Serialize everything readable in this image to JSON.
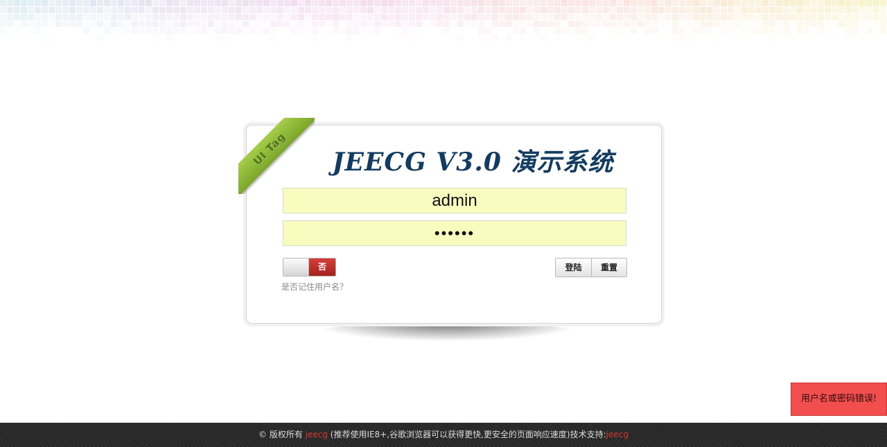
{
  "colors": {
    "title": "#133c63",
    "field_background": "#f8fcbf",
    "ribbon": "#8cb73a",
    "toggle_on": "#c1302b",
    "toast_background": "#f24e4e",
    "footer_background": "#262626",
    "footer_link": "#d8392f"
  },
  "ribbon": {
    "label": "UI Tag"
  },
  "login": {
    "title": "JEECG  V3.0 演示系统",
    "username_value": "admin",
    "password_value": "••••••",
    "remember_toggle_text": "否",
    "remember_label": "是否记住用户名？",
    "login_button": "登陆",
    "reset_button": "重置"
  },
  "toast": {
    "message": "用户名或密码错误!"
  },
  "footer": {
    "prefix": "© 版权所有 ",
    "link1": "jeecg",
    "middle": " (推荐使用IE8+,谷歌浏览器可以获得更快,更安全的页面响应速度)技术支持:",
    "link2": "jeecg"
  }
}
